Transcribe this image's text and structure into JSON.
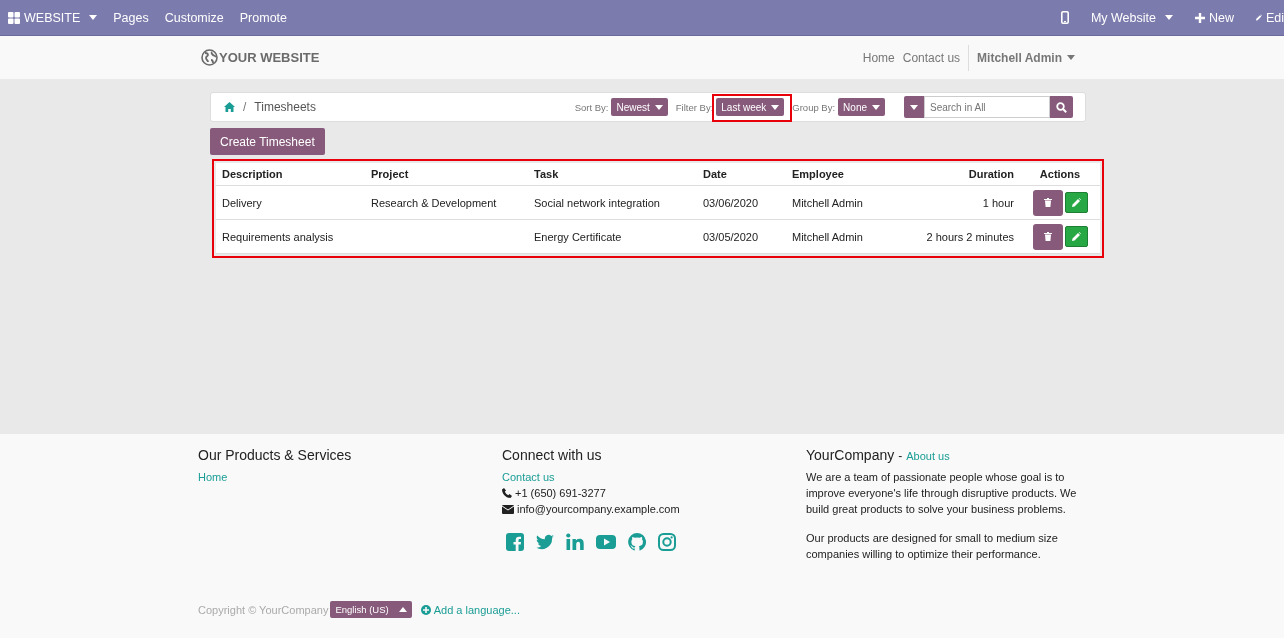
{
  "top_bar": {
    "left": [
      {
        "kind": "apps",
        "label": "WEBSITE"
      },
      {
        "kind": "link",
        "label": "Pages"
      },
      {
        "kind": "link",
        "label": "Customize"
      },
      {
        "kind": "link",
        "label": "Promote"
      }
    ],
    "right": [
      {
        "kind": "mobile"
      },
      {
        "kind": "dropdown",
        "label": "My Website"
      },
      {
        "kind": "new",
        "label": "New"
      },
      {
        "kind": "edit",
        "label": "Edi"
      }
    ]
  },
  "header": {
    "logo": "YOUR WEBSITE",
    "nav": [
      "Home",
      "Contact us"
    ],
    "user": "Mitchell Admin"
  },
  "breadcrumb": {
    "separator": "/",
    "current": "Timesheets"
  },
  "controls": [
    {
      "label": "Sort By:",
      "value": "Newest",
      "highlighted": false
    },
    {
      "label": "Filter By:",
      "value": "Last week",
      "highlighted": true
    },
    {
      "label": "Group By:",
      "value": "None",
      "highlighted": false
    }
  ],
  "search": {
    "placeholder": "Search in All"
  },
  "create_button": "Create Timesheet",
  "table": {
    "highlighted": true,
    "columns": [
      "Description",
      "Project",
      "Task",
      "Date",
      "Employee",
      "Duration",
      "Actions"
    ],
    "rows": [
      {
        "cells": [
          "Delivery",
          "Research & Development",
          "Social network integration",
          "03/06/2020",
          "Mitchell Admin",
          "1 hour"
        ]
      },
      {
        "cells": [
          "Requirements analysis",
          "",
          "Energy Certificate",
          "03/05/2020",
          "Mitchell Admin",
          "2 hours 2 minutes"
        ]
      }
    ]
  },
  "footer": {
    "columns": [
      {
        "title": "Our Products & Services",
        "links": [
          "Home"
        ]
      },
      {
        "title": "Connect with us",
        "links": [
          "Contact us"
        ],
        "phone": "+1 (650) 691-3277",
        "email": "info@yourcompany.example.com",
        "social": [
          {
            "kind": "facebook"
          },
          {
            "kind": "twitter"
          },
          {
            "kind": "linkedin"
          },
          {
            "kind": "youtube"
          },
          {
            "kind": "github"
          },
          {
            "kind": "instagram"
          }
        ]
      },
      {
        "title": "YourCompany",
        "title_separator": "-",
        "title_link": "About us",
        "paragraphs": [
          "We are a team of passionate people whose goal is to improve everyone's life through disruptive products. We build great products to solve your business problems.",
          "Our products are designed for small to medium size companies willing to optimize their performance."
        ]
      }
    ],
    "copyright": "Copyright © YourCompany",
    "language": "English (US)",
    "add_language": "Add a language..."
  }
}
